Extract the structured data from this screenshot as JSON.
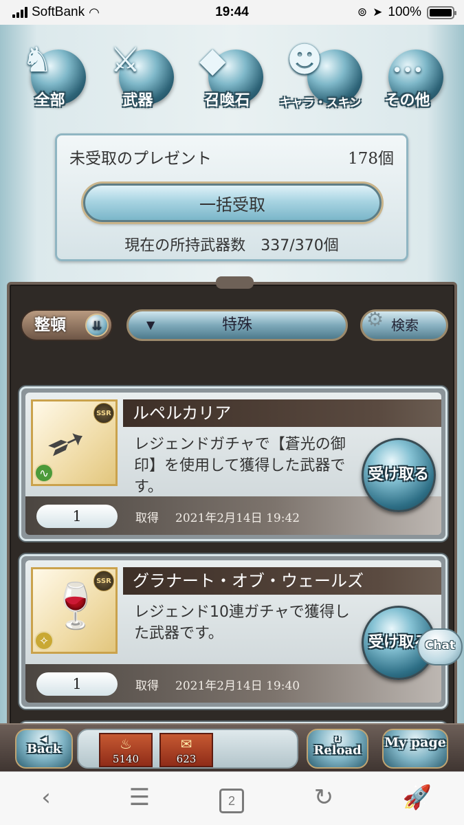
{
  "status_bar": {
    "carrier": "SoftBank",
    "time": "19:44",
    "battery": "100%"
  },
  "categories": [
    {
      "label": "全部",
      "icon": "all-icon",
      "glyph": "♞"
    },
    {
      "label": "武器",
      "icon": "weapon-icon",
      "glyph": "⚔"
    },
    {
      "label": "召喚石",
      "icon": "summon-stone-icon",
      "glyph": "◆"
    },
    {
      "label": "キャラ・スキン",
      "icon": "character-icon",
      "glyph": "☻"
    },
    {
      "label": "その他",
      "icon": "other-icon",
      "glyph": "•••"
    }
  ],
  "present": {
    "title": "未受取のプレゼント",
    "count": "178個",
    "bulk_label": "一括受取",
    "owned_text": "現在の所持武器数　337/370個"
  },
  "filters": {
    "sort_label": "整頓",
    "filter_value": "特殊",
    "search_label": "検索"
  },
  "items": [
    {
      "name": "ルペルカリア",
      "rarity": "SSR",
      "element": "wind",
      "element_color": "#4b9a3a",
      "description": "レジェンドガチャで【蒼光の御印】を使用して獲得した武器です。",
      "quantity": "1",
      "acquired_label": "取得",
      "acquired_date": "2021年2月14日 19:42",
      "receive_label": "受け取る",
      "thumb_glyph": "➶"
    },
    {
      "name": "グラナート・オブ・ウェールズ",
      "rarity": "SSR",
      "element": "light",
      "element_color": "#c9a833",
      "description": "レジェンド10連ガチャで獲得した武器です。",
      "quantity": "1",
      "acquired_label": "取得",
      "acquired_date": "2021年2月14日 19:40",
      "receive_label": "受け取る",
      "thumb_glyph": "🍷"
    }
  ],
  "chat_label": "Chat",
  "game_bar": {
    "back_label": "Back",
    "reload_label": "Reload",
    "mypage_label": "My page",
    "item_counts": [
      "5140",
      "623"
    ]
  },
  "browser_toolbar": {
    "tab_count": "2"
  }
}
